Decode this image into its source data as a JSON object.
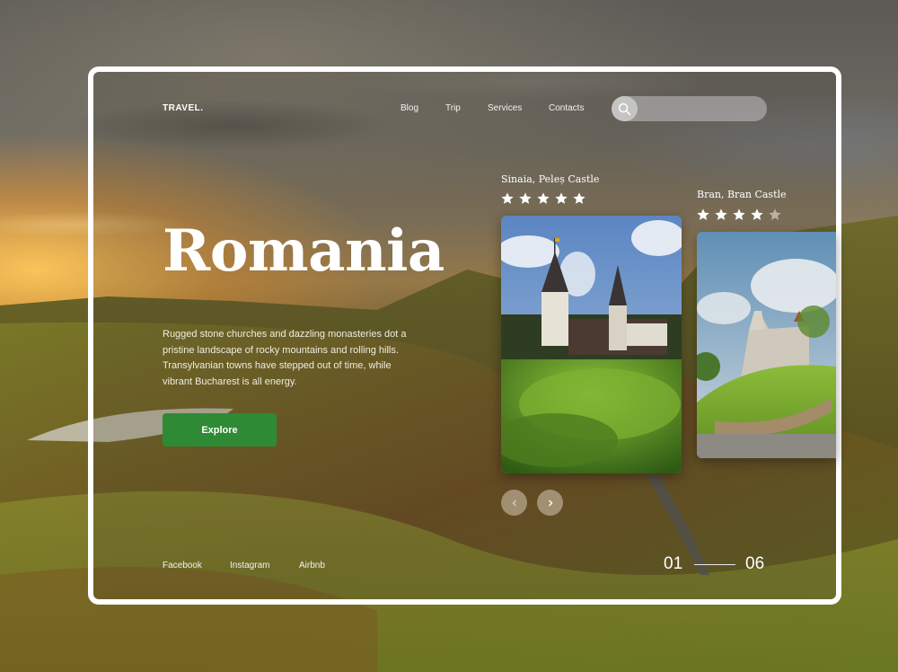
{
  "header": {
    "logo": "TRAVEL.",
    "nav": [
      "Blog",
      "Trip",
      "Services",
      "Contacts"
    ],
    "search": {
      "placeholder": "",
      "value": "",
      "icon": "search-icon"
    }
  },
  "hero": {
    "title": "Romania",
    "description": "Rugged stone churches and dazzling monasteries dot a pristine landscape of rocky mountains and rolling hills. Transylvanian towns have stepped out of time, while vibrant Bucharest is all energy.",
    "cta_label": "Explore"
  },
  "destinations": [
    {
      "name": "Sinaia, Peleș Castle",
      "rating": 5,
      "max_rating": 5
    },
    {
      "name": "Bran, Bran Castle",
      "rating": 4,
      "max_rating": 5
    }
  ],
  "slider": {
    "prev_icon": "chevron-left-icon",
    "next_icon": "chevron-right-icon",
    "current": "01",
    "total": "06"
  },
  "footer": {
    "social": [
      "Facebook",
      "Instagram",
      "Airbnb"
    ]
  },
  "colors": {
    "accent": "#2f8a36",
    "frame": "#ffffff",
    "star_filled": "#ffffff",
    "star_empty": "#b9b3a3"
  }
}
